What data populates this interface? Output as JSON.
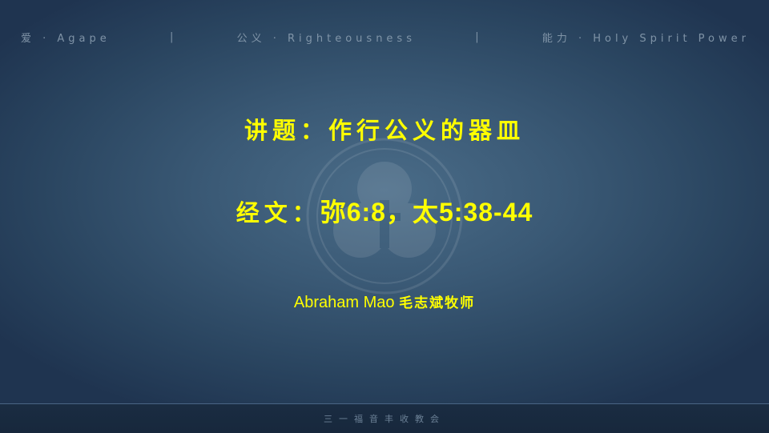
{
  "banner": {
    "items": [
      "爱 · Agape",
      "|",
      "公义 · Righteousness",
      "|",
      "能力 · Holy Spirit Power"
    ]
  },
  "slide": {
    "topic": "讲题：作行公义的器皿",
    "scripture_label": "经文：",
    "scripture_refs": "弥6:8，太5:38-44",
    "speaker_name": "Abraham Mao",
    "speaker_cn": "毛志斌牧师"
  },
  "footer": {
    "church_name": "三一福音丰收教会"
  },
  "colors": {
    "title": "#ffff00",
    "background": "#3a5975",
    "footer_bar": "#1a2c42"
  },
  "icons": {
    "watermark": "church-logo-watermark-icon"
  }
}
